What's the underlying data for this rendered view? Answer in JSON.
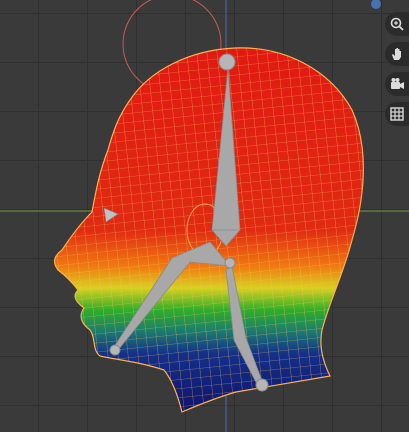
{
  "viewport": {
    "mode": "weight-paint",
    "active_bone_count": 3,
    "colors": {
      "background": "#3a3a3a",
      "grid_line": "#2f2f2f",
      "x_axis": "#7a9a3a",
      "y_axis": "#4a6fa8",
      "wire": "#ffc060",
      "bone": "#a8a8a8",
      "weight_high": "#e01a12",
      "weight_mid": "#2fae2a",
      "weight_low": "#10146a",
      "selection_circle": "#c85a5a"
    }
  },
  "nav_gizmo": {
    "buttons": [
      {
        "icon": "zoom-icon"
      },
      {
        "icon": "pan-hand-icon"
      },
      {
        "icon": "camera-icon"
      },
      {
        "icon": "grid-view-icon"
      }
    ]
  }
}
